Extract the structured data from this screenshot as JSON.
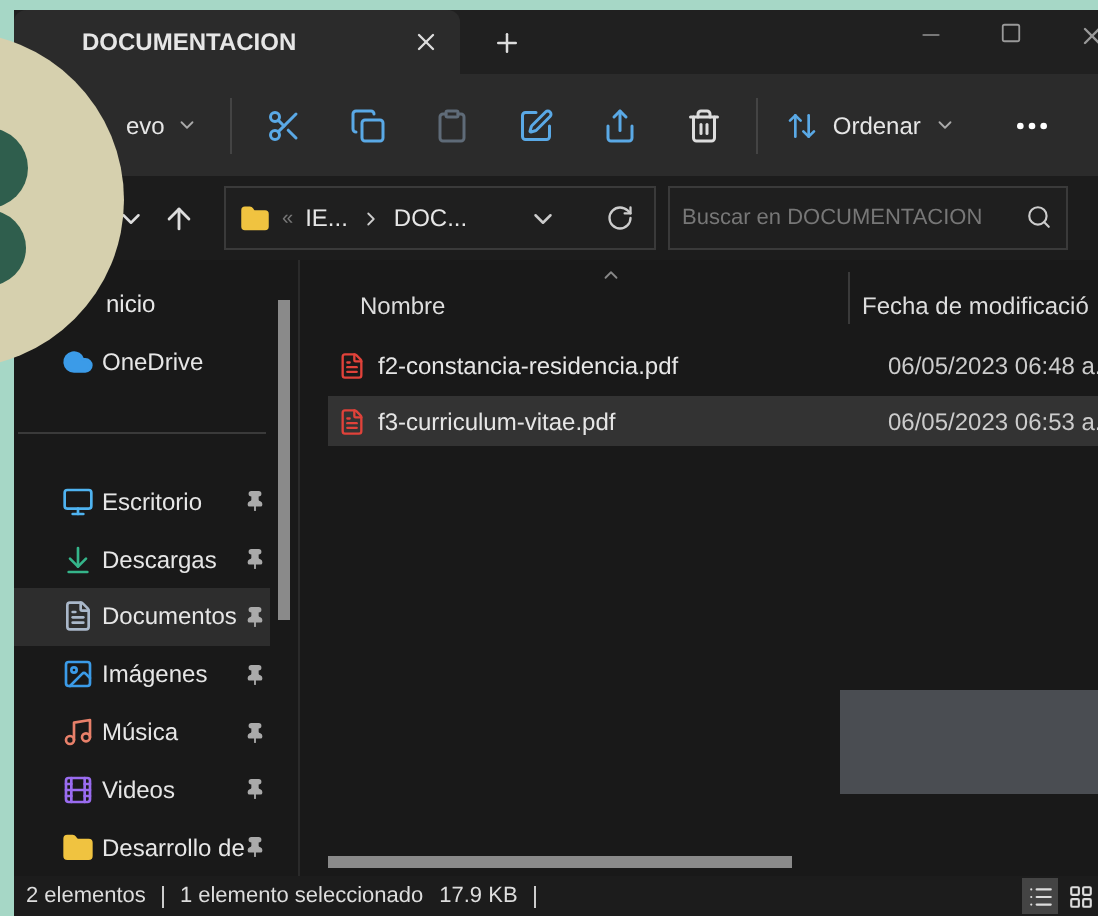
{
  "tab": {
    "title": "DOCUMENTACION"
  },
  "toolbar": {
    "new_label": "evo",
    "sort_label": "Ordenar"
  },
  "address": {
    "overflow_glyph": "«",
    "crumbs": [
      "IE...",
      "DOC..."
    ]
  },
  "search": {
    "placeholder": "Buscar en DOCUMENTACION"
  },
  "sidebar": {
    "items": [
      {
        "label": "nicio",
        "kind": "covered",
        "pinned": false,
        "selected": false
      },
      {
        "label": "OneDrive",
        "kind": "cloud",
        "pinned": false,
        "selected": false
      },
      {
        "label": "Escritorio",
        "kind": "desktop",
        "pinned": true,
        "selected": false
      },
      {
        "label": "Descargas",
        "kind": "download",
        "pinned": true,
        "selected": false
      },
      {
        "label": "Documentos",
        "kind": "document",
        "pinned": true,
        "selected": true
      },
      {
        "label": "Imágenes",
        "kind": "image",
        "pinned": true,
        "selected": false
      },
      {
        "label": "Música",
        "kind": "music",
        "pinned": true,
        "selected": false
      },
      {
        "label": "Videos",
        "kind": "video",
        "pinned": true,
        "selected": false
      },
      {
        "label": "Desarrollo de",
        "kind": "folder",
        "pinned": true,
        "selected": false
      }
    ]
  },
  "columns": [
    "Nombre",
    "Fecha de modificació"
  ],
  "files": [
    {
      "name": "f2-constancia-residencia.pdf",
      "modified": "06/05/2023 06:48 a.",
      "selected": false
    },
    {
      "name": "f3-curriculum-vitae.pdf",
      "modified": "06/05/2023 06:53 a.",
      "selected": true
    }
  ],
  "status_bar": {
    "count": "2 elementos",
    "selection": "1 elemento seleccionado",
    "size": "17.9 KB"
  }
}
